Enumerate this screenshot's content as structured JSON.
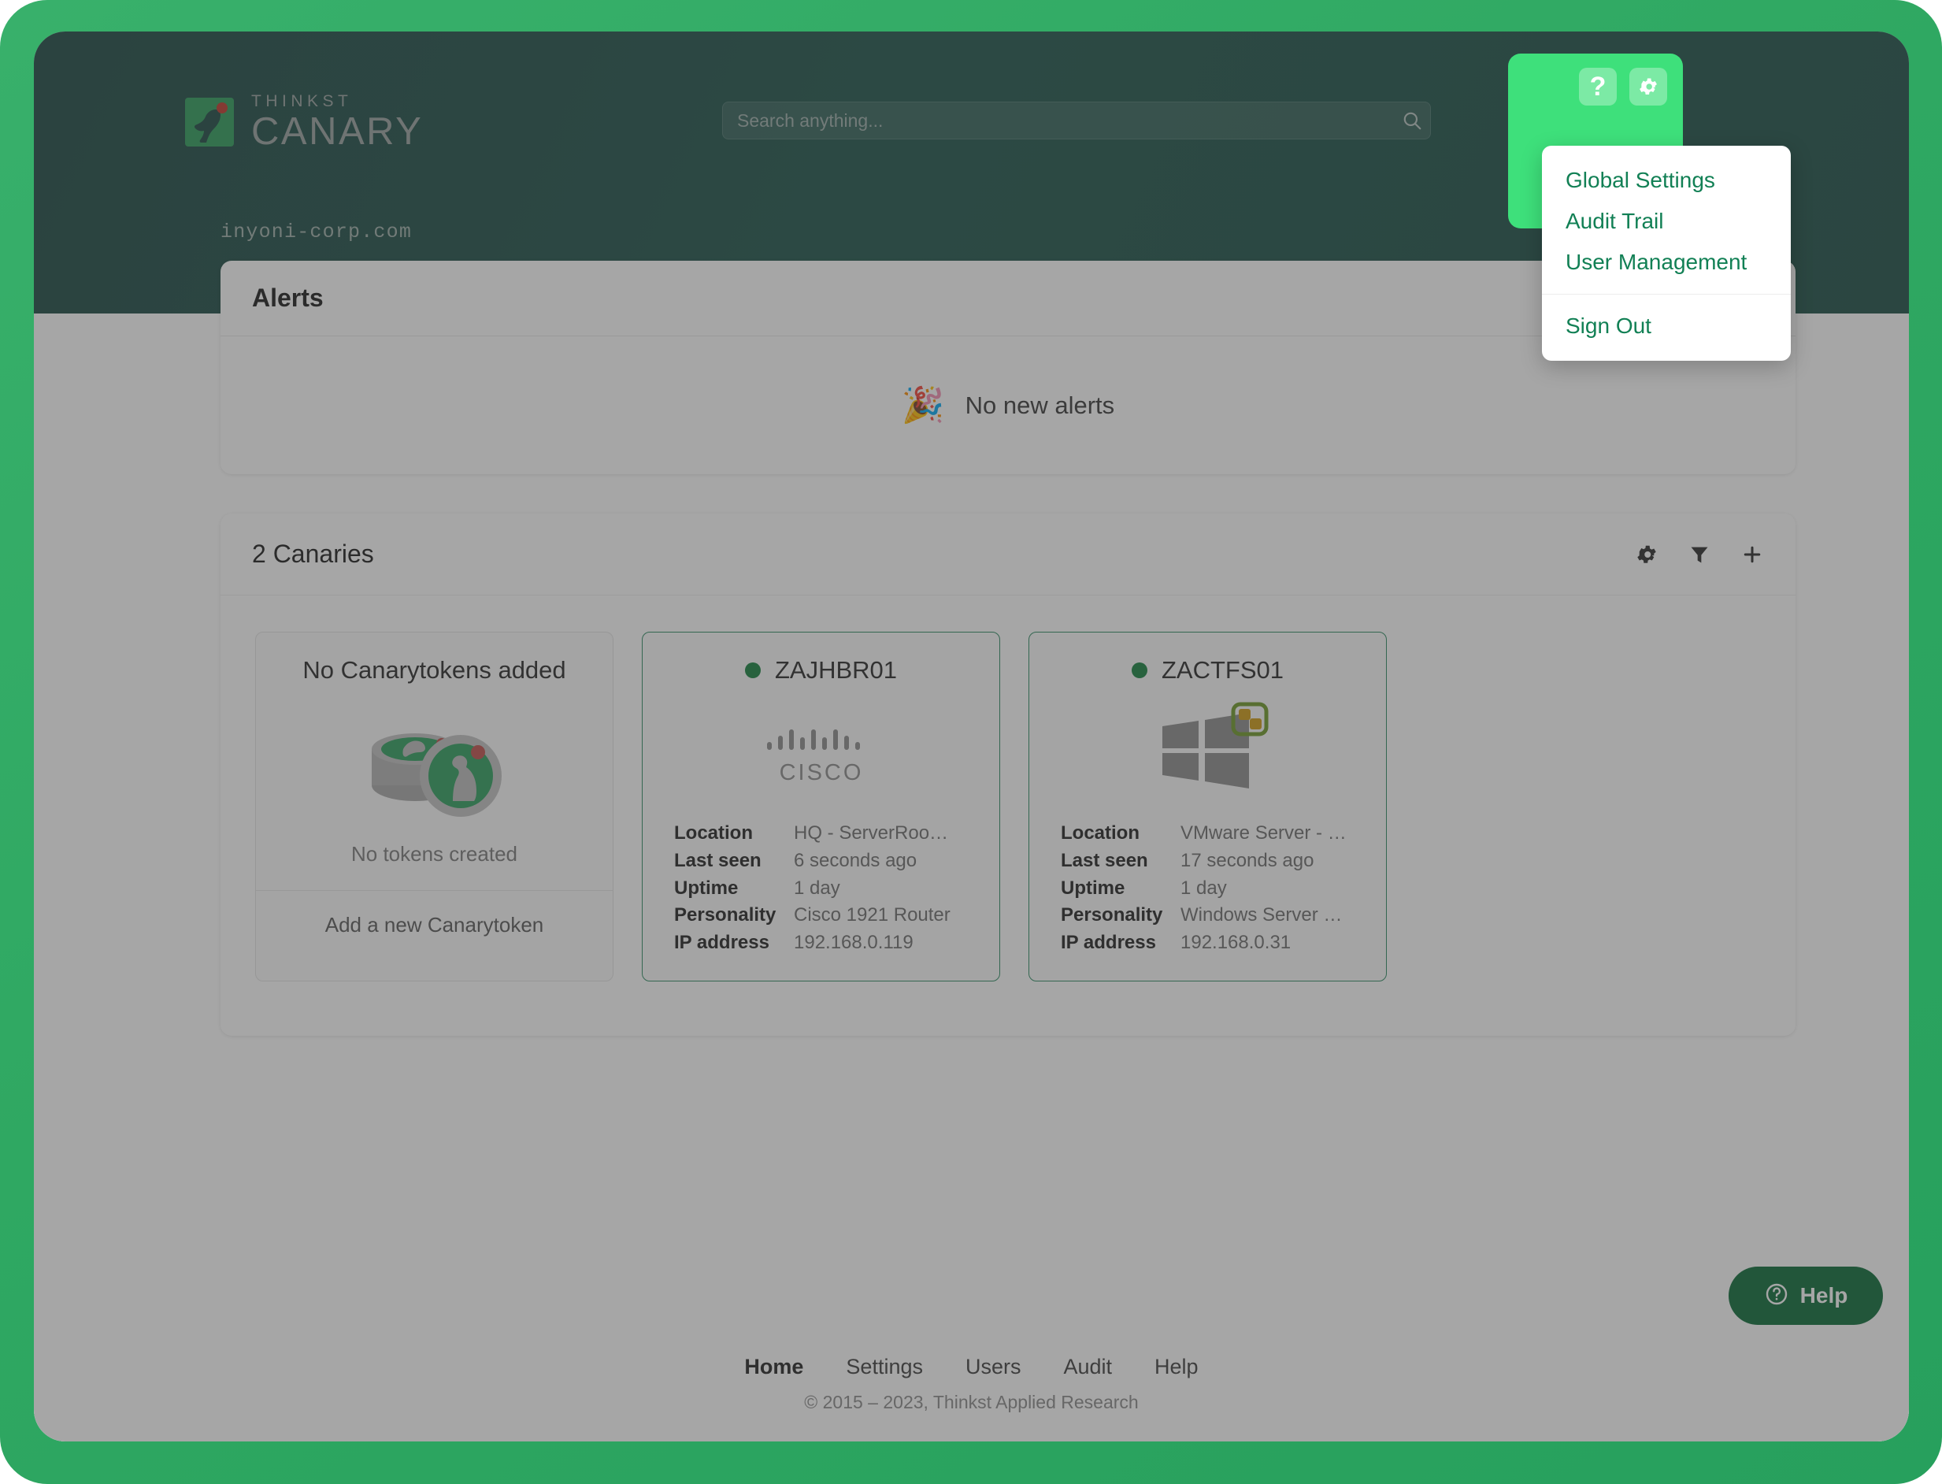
{
  "brand": {
    "thinkst": "THINKST",
    "canary": "CANARY",
    "logo_mark_color": "#2e9e5b",
    "logo_dot_color": "#c0392b"
  },
  "search": {
    "placeholder": "Search anything...",
    "value": "",
    "icon": "search-icon"
  },
  "header": {
    "domain": "inyoni-corp.com",
    "help_button_icon": "question-mark-icon",
    "settings_button_icon": "gear-icon"
  },
  "dropdown": {
    "items": [
      {
        "label": "Global Settings"
      },
      {
        "label": "Audit Trail"
      },
      {
        "label": "User Management"
      }
    ],
    "sign_out": "Sign Out"
  },
  "alerts": {
    "title": "Alerts",
    "empty_icon": "party-popper-icon",
    "empty_emoji": "🎉",
    "empty_text": "No new alerts"
  },
  "canaries": {
    "title": "2 Canaries",
    "icons": [
      "gear-icon",
      "filter-icon",
      "plus-icon"
    ],
    "token_tile": {
      "title": "No Canarytokens added",
      "art": "canarytoken-coins-icon",
      "empty_text": "No tokens created",
      "action": "Add a new Canarytoken"
    },
    "devices": [
      {
        "name": "ZAJHBR01",
        "status_color": "#17823f",
        "art": "cisco-logo-icon",
        "fields": [
          {
            "key": "Location",
            "value": "HQ - ServerRoo…"
          },
          {
            "key": "Last seen",
            "value": "6 seconds ago"
          },
          {
            "key": "Uptime",
            "value": "1 day"
          },
          {
            "key": "Personality",
            "value": "Cisco 1921 Router"
          },
          {
            "key": "IP address",
            "value": "192.168.0.119"
          }
        ]
      },
      {
        "name": "ZACTFS01",
        "status_color": "#17823f",
        "art": "windows-vmware-logo-icon",
        "fields": [
          {
            "key": "Location",
            "value": "VMware Server - …"
          },
          {
            "key": "Last seen",
            "value": "17 seconds ago"
          },
          {
            "key": "Uptime",
            "value": "1 day"
          },
          {
            "key": "Personality",
            "value": "Windows Server …"
          },
          {
            "key": "IP address",
            "value": "192.168.0.31"
          }
        ]
      }
    ]
  },
  "help_widget": {
    "label": "Help",
    "icon": "question-circle-icon",
    "color": "#0c6b38"
  },
  "footer": {
    "nav": [
      {
        "label": "Home",
        "active": true
      },
      {
        "label": "Settings",
        "active": false
      },
      {
        "label": "Users",
        "active": false
      },
      {
        "label": "Audit",
        "active": false
      },
      {
        "label": "Help",
        "active": false
      }
    ],
    "copyright": "© 2015 – 2023, Thinkst Applied Research"
  },
  "theme": {
    "frame_green": "#30a862",
    "header_teal": "#1e544a",
    "spotlight_green": "#3ee07b",
    "menu_text_green": "#128055"
  }
}
